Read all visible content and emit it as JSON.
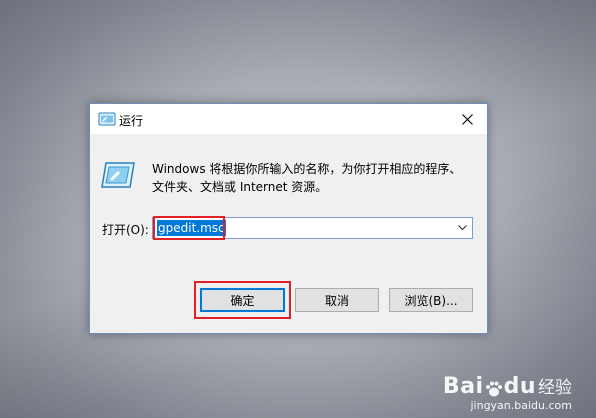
{
  "dialog": {
    "title": "运行",
    "description_line1": "Windows 将根据你所输入的名称，为你打开相应的程序、",
    "description_line2": "文件夹、文档或 Internet 资源。",
    "open_label": "打开(O):",
    "open_value": "gpedit.msc",
    "buttons": {
      "ok": "确定",
      "cancel": "取消",
      "browse": "浏览(B)..."
    },
    "icons": [
      "run-icon",
      "close-icon",
      "chevron-down-icon"
    ]
  },
  "highlight_color": "#e0212b",
  "selection_color": "#0078d7",
  "watermark": {
    "brand": "Bai",
    "brand_tail": "du",
    "product": "经验",
    "url": "jingyan.baidu.com"
  }
}
